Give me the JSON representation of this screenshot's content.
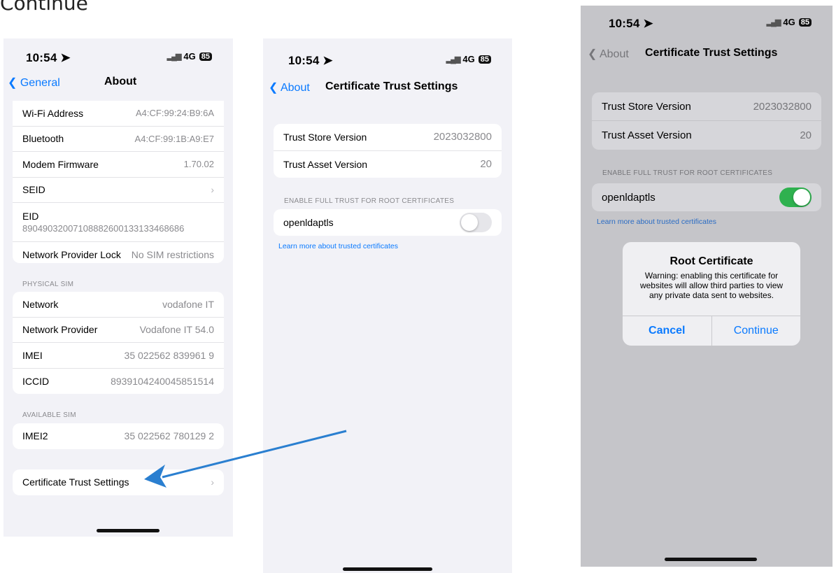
{
  "heading": "Continue",
  "status": {
    "time": "10:54",
    "network": "4G",
    "battery": "85"
  },
  "about": {
    "back_label": "General",
    "title": "About",
    "rows_top": [
      {
        "label": "Wi-Fi Address",
        "value": "A4:CF:99:24:B9:6A"
      },
      {
        "label": "Bluetooth",
        "value": "A4:CF:99:1B:A9:E7"
      },
      {
        "label": "Modem Firmware",
        "value": "1.70.02"
      },
      {
        "label": "SEID",
        "value": ""
      }
    ],
    "eid": {
      "label": "EID",
      "value": "89049032007108882600133133468686"
    },
    "lock": {
      "label": "Network Provider Lock",
      "value": "No SIM restrictions"
    },
    "physical_sim_label": "PHYSICAL SIM",
    "rows_sim": [
      {
        "label": "Network",
        "value": "vodafone IT"
      },
      {
        "label": "Network Provider",
        "value": "Vodafone IT 54.0"
      },
      {
        "label": "IMEI",
        "value": "35 022562 839961 9"
      },
      {
        "label": "ICCID",
        "value": "8939104240045851514"
      }
    ],
    "available_sim_label": "AVAILABLE SIM",
    "imei2": {
      "label": "IMEI2",
      "value": "35 022562 780129 2"
    },
    "cert_trust": "Certificate Trust Settings"
  },
  "trust": {
    "back_label": "About",
    "title": "Certificate Trust Settings",
    "rows": [
      {
        "label": "Trust Store Version",
        "value": "2023032800"
      },
      {
        "label": "Trust Asset Version",
        "value": "20"
      }
    ],
    "section_label": "ENABLE FULL TRUST FOR ROOT CERTIFICATES",
    "cert_name": "openldaptls",
    "link": "Learn more about trusted certificates"
  },
  "alert": {
    "title": "Root Certificate",
    "message": "Warning: enabling this certificate for websites will allow third parties to view any private data sent to websites.",
    "cancel": "Cancel",
    "continue": "Continue"
  },
  "colors": {
    "accent": "#0a7aff",
    "toggle_on": "#34c759",
    "arrow": "#2a7fd0"
  },
  "toggle_states": {
    "phone2": "off",
    "phone3": "on"
  }
}
